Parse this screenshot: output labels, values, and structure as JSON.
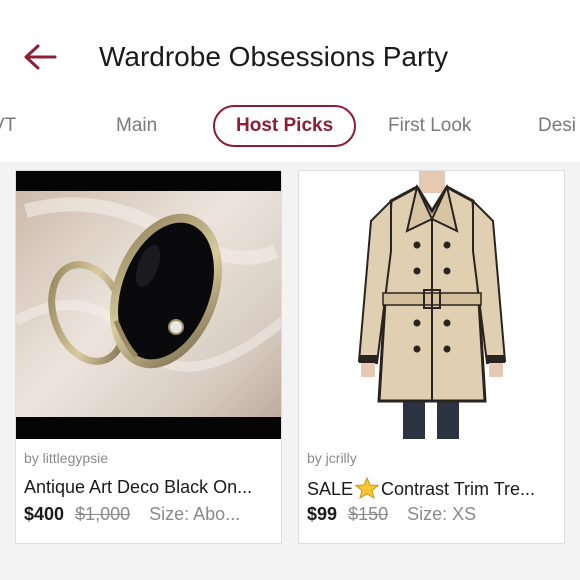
{
  "header": {
    "title": "Wardrobe Obsessions Party",
    "back_icon": "arrow-left-icon",
    "accent_color": "#8e1e35"
  },
  "tabs": [
    {
      "label": "VT",
      "active": false
    },
    {
      "label": "Main",
      "active": false
    },
    {
      "label": "Host Picks",
      "active": true
    },
    {
      "label": "First Look",
      "active": false
    },
    {
      "label": "Desi",
      "active": false
    }
  ],
  "listings": [
    {
      "seller": "by littlegypsie",
      "title": "Antique Art Deco Black On...",
      "price": "$400",
      "original_price": "$1,000",
      "size": "Size: Abo...",
      "image": "black-onyx-ring-photo"
    },
    {
      "seller": "by jcrilly",
      "title_prefix": "SALE",
      "title_icon": "star-icon",
      "title_suffix": "Contrast Trim Tre...",
      "price": "$99",
      "original_price": "$150",
      "size": "Size: XS",
      "image": "beige-trench-coat-photo"
    }
  ]
}
